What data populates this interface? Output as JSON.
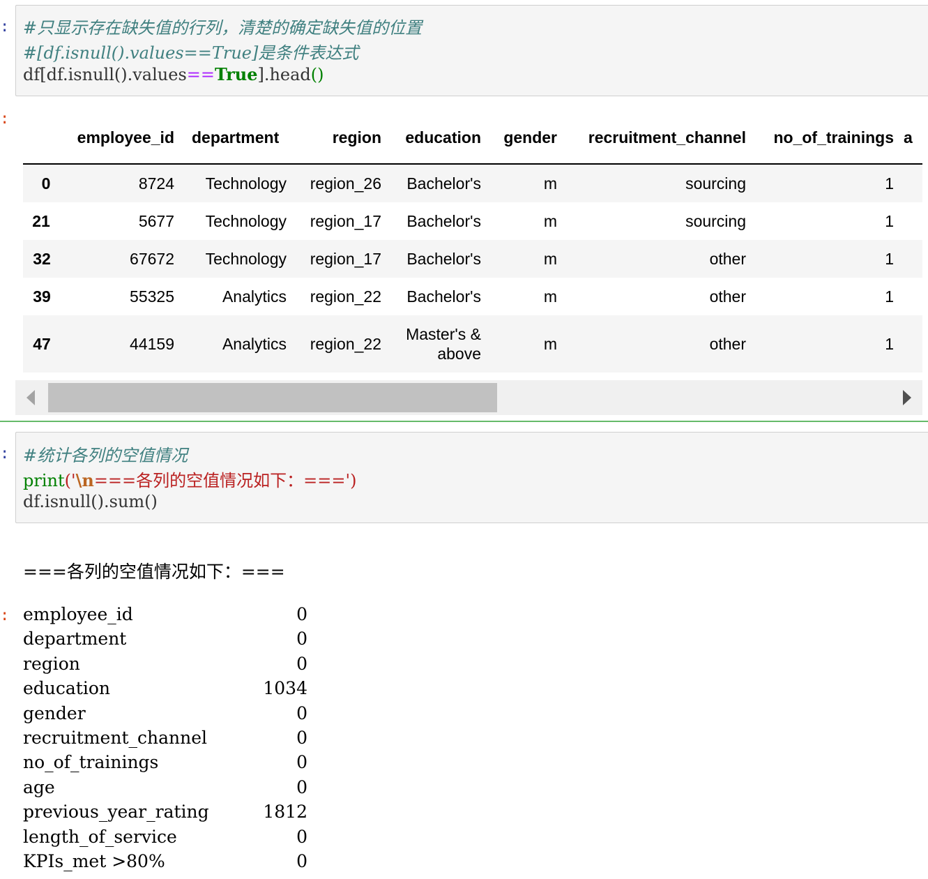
{
  "cell1": {
    "prompt": ":",
    "lines": [
      "#只显示存在缺失值的行列，清楚的确定缺失值的位置",
      "#[df.isnull().values==True]是条件表达式"
    ],
    "code_pre": "df[df.isnull().values",
    "code_op": "==",
    "code_kw": "True",
    "code_post": "].head",
    "code_paren": "()"
  },
  "output1": {
    "prompt": ":",
    "columns": [
      "",
      "employee_id",
      "department",
      "region",
      "education",
      "gender",
      "recruitment_channel",
      "no_of_trainings",
      "a"
    ],
    "rows": [
      {
        "index": "0",
        "employee_id": "8724",
        "department": "Technology",
        "region": "region_26",
        "education": "Bachelor's",
        "gender": "m",
        "recruitment_channel": "sourcing",
        "no_of_trainings": "1"
      },
      {
        "index": "21",
        "employee_id": "5677",
        "department": "Technology",
        "region": "region_17",
        "education": "Bachelor's",
        "gender": "m",
        "recruitment_channel": "sourcing",
        "no_of_trainings": "1"
      },
      {
        "index": "32",
        "employee_id": "67672",
        "department": "Technology",
        "region": "region_17",
        "education": "Bachelor's",
        "gender": "m",
        "recruitment_channel": "other",
        "no_of_trainings": "1"
      },
      {
        "index": "39",
        "employee_id": "55325",
        "department": "Analytics",
        "region": "region_22",
        "education": "Bachelor's",
        "gender": "m",
        "recruitment_channel": "other",
        "no_of_trainings": "1"
      },
      {
        "index": "47",
        "employee_id": "44159",
        "department": "Analytics",
        "region": "region_22",
        "education_line1": "Master's &",
        "education_line2": "above",
        "gender": "m",
        "recruitment_channel": "other",
        "no_of_trainings": "1"
      }
    ]
  },
  "cell2": {
    "prompt": ":",
    "comment": "#统计各列的空值情况",
    "print_fn": "print",
    "print_open": "('",
    "print_esc": "\\n",
    "print_str": "===各列的空值情况如下：===",
    "print_close": "')",
    "line3": "df.isnull().sum()"
  },
  "output2": {
    "stdout": "===各列的空值情况如下：===",
    "prompt": ":",
    "series": [
      {
        "name": "employee_id",
        "value": "0"
      },
      {
        "name": "department",
        "value": "0"
      },
      {
        "name": "region",
        "value": "0"
      },
      {
        "name": "education",
        "value": "1034"
      },
      {
        "name": "gender",
        "value": "0"
      },
      {
        "name": "recruitment_channel",
        "value": "0"
      },
      {
        "name": "no_of_trainings",
        "value": "0"
      },
      {
        "name": "age",
        "value": "0"
      },
      {
        "name": "previous_year_rating",
        "value": "1812"
      },
      {
        "name": "length_of_service",
        "value": "0"
      },
      {
        "name": "KPIs_met >80%",
        "value": "0"
      }
    ]
  },
  "colors": {
    "comment": "#408080",
    "keyword": "#008000",
    "operator": "#aa22ff",
    "string": "#ba2121",
    "cell_border": "#cfcfcf",
    "selected_cell": "#66bb6a"
  }
}
